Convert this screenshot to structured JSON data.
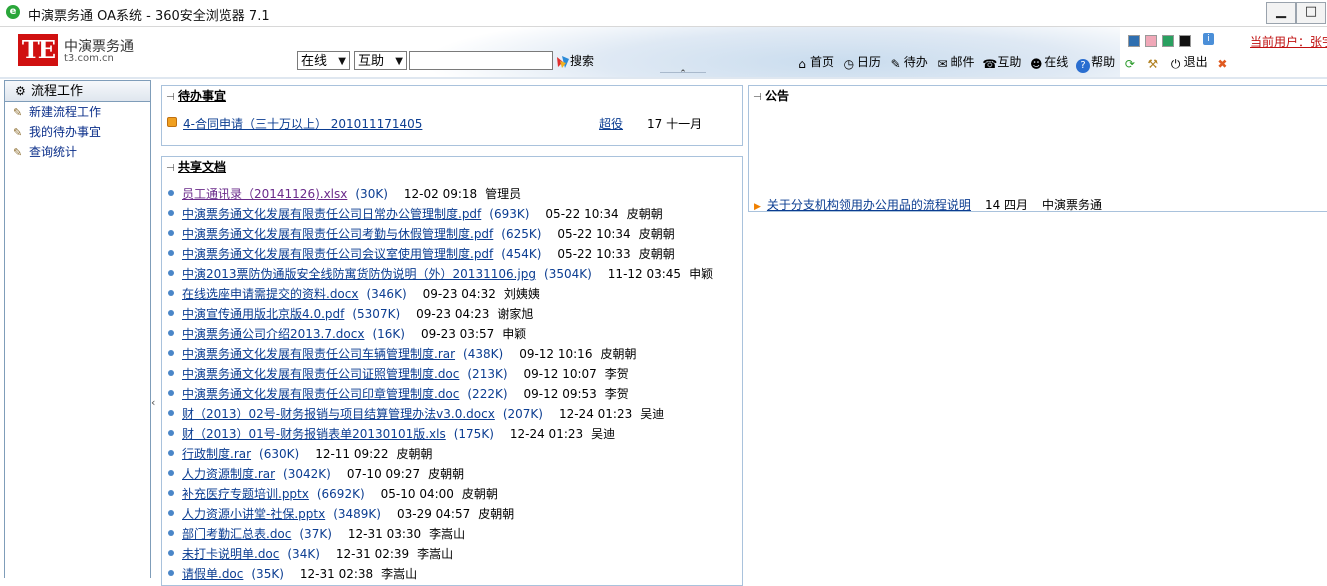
{
  "window": {
    "title": "中演票务通 OA系统 - 360安全浏览器 7.1",
    "minimize": "▁",
    "maximize": "□"
  },
  "header": {
    "logo_mark": "TE",
    "logo_name": "中演票务通",
    "logo_domain": "t3.com.cn",
    "select1": "在线",
    "select2": "互助",
    "search_value": "",
    "search_label": "搜索",
    "swatch_colors": [
      "#2f6fb0",
      "#f0a8b8",
      "#2aa060",
      "#111111"
    ],
    "current_user": "当前用户：张宇",
    "nav": [
      {
        "label": "首页",
        "icon": "⌂"
      },
      {
        "label": "日历",
        "icon": "◷"
      },
      {
        "label": "待办",
        "icon": "✎"
      },
      {
        "label": "邮件",
        "icon": "✉"
      },
      {
        "label": "互助",
        "icon": "☎"
      },
      {
        "label": "在线",
        "icon": "☻"
      },
      {
        "label": "帮助",
        "icon": "?"
      },
      {
        "label": "",
        "icon": "⟳"
      },
      {
        "label": "",
        "icon": "⚒"
      },
      {
        "label": "退出",
        "icon": "⏻"
      },
      {
        "label": "",
        "icon": "✖"
      }
    ]
  },
  "sidebar": {
    "title": "流程工作",
    "items": [
      {
        "label": "新建流程工作"
      },
      {
        "label": "我的待办事宜"
      },
      {
        "label": "查询统计"
      }
    ]
  },
  "todo": {
    "title": "待办事宜",
    "item": {
      "name": "4-合同申请（三十万以上） 201011171405",
      "action": "超役",
      "date": "17 十一月"
    }
  },
  "notice": {
    "title": "公告",
    "item": {
      "name": "关于分支机构领用办公用品的流程说明",
      "date": "14 四月",
      "source": "中演票务通"
    }
  },
  "shared": {
    "title": "共享文档",
    "docs": [
      {
        "name": "员工通讯录（20141126).xlsx",
        "size": "(30K)",
        "date": "12-02 09:18",
        "user": "管理员",
        "visited": true
      },
      {
        "name": "中演票务通文化发展有限责任公司日常办公管理制度.pdf",
        "size": "(693K)",
        "date": "05-22 10:34",
        "user": "皮朝朝"
      },
      {
        "name": "中演票务通文化发展有限责任公司考勤与休假管理制度.pdf",
        "size": "(625K)",
        "date": "05-22 10:34",
        "user": "皮朝朝"
      },
      {
        "name": "中演票务通文化发展有限责任公司会议室使用管理制度.pdf",
        "size": "(454K)",
        "date": "05-22 10:33",
        "user": "皮朝朝"
      },
      {
        "name": "中演2013票防伪通版安全线防寓货防伪说明（外）20131106.jpg",
        "size": "(3504K)",
        "date": "11-12 03:45",
        "user": "申颖"
      },
      {
        "name": "在线选座申请需提交的资料.docx",
        "size": "(346K)",
        "date": "09-23 04:32",
        "user": "刘姨姨"
      },
      {
        "name": "中演宣传通用版北京版4.0.pdf",
        "size": "(5307K)",
        "date": "09-23 04:23",
        "user": "谢家旭"
      },
      {
        "name": "中演票务通公司介绍2013.7.docx",
        "size": "(16K)",
        "date": "09-23 03:57",
        "user": "申颖"
      },
      {
        "name": "中演票务通文化发展有限责任公司车辆管理制度.rar",
        "size": "(438K)",
        "date": "09-12 10:16",
        "user": "皮朝朝"
      },
      {
        "name": "中演票务通文化发展有限责任公司证照管理制度.doc",
        "size": "(213K)",
        "date": "09-12 10:07",
        "user": "李贺"
      },
      {
        "name": "中演票务通文化发展有限责任公司印章管理制度.doc",
        "size": "(222K)",
        "date": "09-12 09:53",
        "user": "李贺"
      },
      {
        "name": "财（2013）02号-财务报销与项目结算管理办法v3.0.docx",
        "size": "(207K)",
        "date": "12-24 01:23",
        "user": "吴迪"
      },
      {
        "name": "财（2013）01号-财务报销表单20130101版.xls",
        "size": "(175K)",
        "date": "12-24 01:23",
        "user": "吴迪"
      },
      {
        "name": "行政制度.rar",
        "size": "(630K)",
        "date": "12-11 09:22",
        "user": "皮朝朝"
      },
      {
        "name": "人力资源制度.rar",
        "size": "(3042K)",
        "date": "07-10 09:27",
        "user": "皮朝朝"
      },
      {
        "name": "补充医疗专题培训.pptx",
        "size": "(6692K)",
        "date": "05-10 04:00",
        "user": "皮朝朝"
      },
      {
        "name": "人力资源小讲堂-社保.pptx",
        "size": "(3489K)",
        "date": "03-29 04:57",
        "user": "皮朝朝"
      },
      {
        "name": "部门考勤汇总表.doc",
        "size": "(37K)",
        "date": "12-31 03:30",
        "user": "李嵩山"
      },
      {
        "name": "未打卡说明单.doc",
        "size": "(34K)",
        "date": "12-31 02:39",
        "user": "李嵩山"
      },
      {
        "name": "请假单.doc",
        "size": "(35K)",
        "date": "12-31 02:38",
        "user": "李嵩山"
      }
    ]
  }
}
